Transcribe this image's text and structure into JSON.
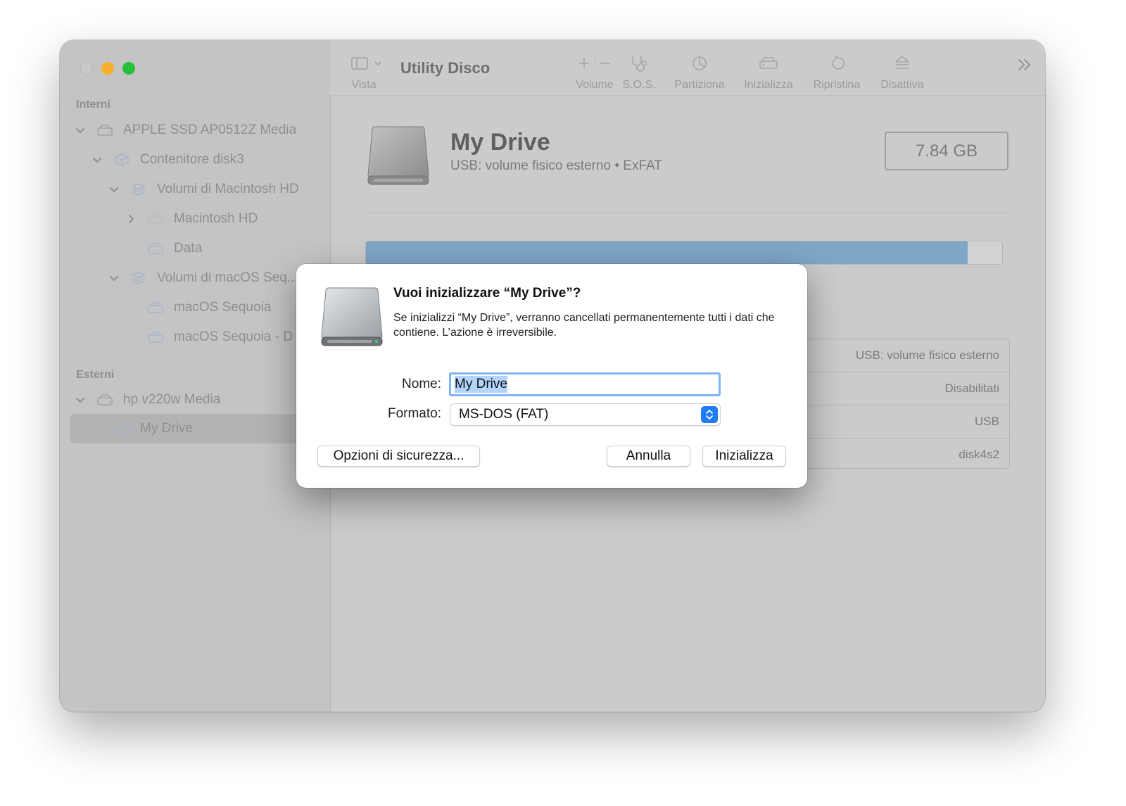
{
  "toolbar": {
    "title": "Utility Disco",
    "view_label": "Vista",
    "volume_label": "Volume",
    "sos_label": "S.O.S.",
    "partition_label": "Partiziona",
    "erase_label": "Inizializza",
    "restore_label": "Ripristina",
    "unmount_label": "Disattiva"
  },
  "sidebar": {
    "internal_header": "Interni",
    "external_header": "Esterni",
    "items": [
      {
        "label": "APPLE SSD AP0512Z Media"
      },
      {
        "label": "Contenitore disk3"
      },
      {
        "label": "Volumi di Macintosh HD"
      },
      {
        "label": "Macintosh HD"
      },
      {
        "label": "Data"
      },
      {
        "label": "Volumi di macOS Seq..."
      },
      {
        "label": "macOS Sequoia"
      },
      {
        "label": "macOS Sequoia - D"
      },
      {
        "label": "hp v220w Media"
      },
      {
        "label": "My Drive"
      }
    ]
  },
  "main": {
    "drive_name": "My Drive",
    "drive_subtitle": "USB: volume fisico esterno • ExFAT",
    "capacity": "7.84 GB",
    "usage_fraction": 0.946,
    "info_rows": [
      {
        "value": "USB: volume fisico esterno"
      },
      {
        "value": "Disabilitati"
      },
      {
        "value": "USB"
      },
      {
        "value": "disk4s2"
      }
    ]
  },
  "dialog": {
    "title": "Vuoi inizializzare “My Drive”?",
    "message": "Se inizializzi “My Drive”, verranno cancellati permanentemente tutti i dati che contiene. L’azione è irreversibile.",
    "name_label": "Nome:",
    "name_value": "My Drive",
    "format_label": "Formato:",
    "format_value": "MS-DOS (FAT)",
    "security_button": "Opzioni di sicurezza...",
    "cancel_button": "Annulla",
    "erase_button": "Inizializza"
  },
  "colors": {
    "accent": "#1f7cf5",
    "usage_fill": "#7ea6c7",
    "traffic_min": "#f6b02b",
    "traffic_max": "#27c03c"
  }
}
